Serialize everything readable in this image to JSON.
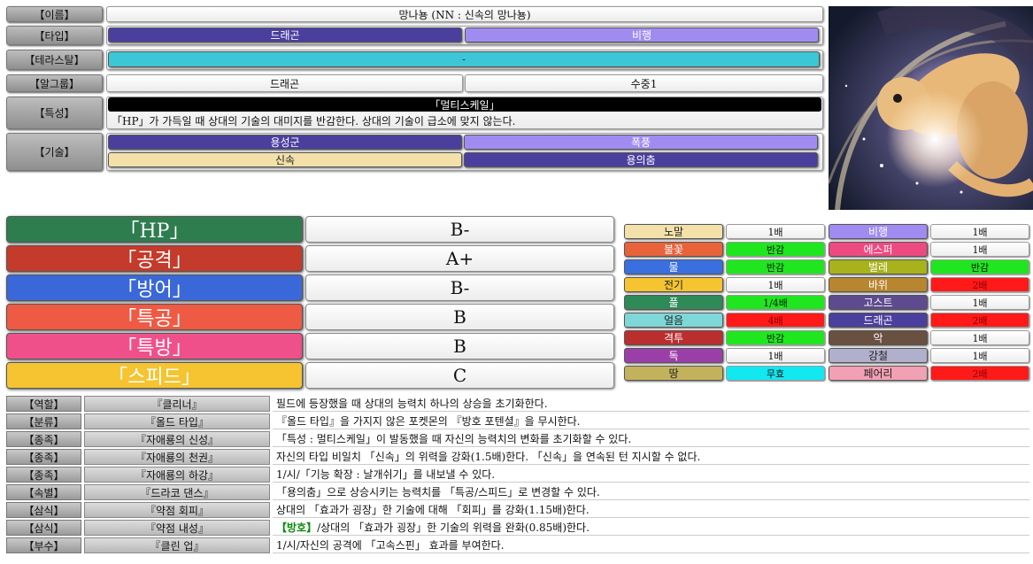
{
  "info": {
    "name_label": "【이름】",
    "name_value": "망나뇽 (NN : 신속의 망나뇽)",
    "type_label": "【타입】",
    "types": [
      {
        "name": "드래곤",
        "color": "#4b3f9e"
      },
      {
        "name": "비행",
        "color": "#a08cf0"
      }
    ],
    "tera_label": "【테라스탈】",
    "tera_value": "-",
    "tera_color": "#3cc6d6",
    "egg_label": "【알그룹】",
    "egg_groups": [
      "드래곤",
      "수중1"
    ],
    "ability_label": "【특성】",
    "ability_name": "「멀티스케일」",
    "ability_desc": "「HP」가 가득일 때 상대의 기술의 대미지를 반감한다. 상대의 기술이 급소에 맞지 않는다.",
    "moves_label": "【기술】",
    "moves": [
      {
        "name": "용성군",
        "color": "#4b3f9e"
      },
      {
        "name": "폭풍",
        "color": "#a08cf0"
      },
      {
        "name": "신속",
        "color": "#f3e1a9"
      },
      {
        "name": "용의춤",
        "color": "#4b3f9e"
      }
    ]
  },
  "artwork": {
    "name": "dragonite-artwork"
  },
  "stats": [
    {
      "label": "「HP」",
      "grade": "B-",
      "color": "#2e7d4f"
    },
    {
      "label": "「공격」",
      "grade": "A+",
      "color": "#c43a2b"
    },
    {
      "label": "「방어」",
      "grade": "B-",
      "color": "#3b68d8"
    },
    {
      "label": "「특공」",
      "grade": "B",
      "color": "#ee5a43"
    },
    {
      "label": "「특방」",
      "grade": "B",
      "color": "#f0508a"
    },
    {
      "label": "「스피드」",
      "grade": "C",
      "color": "#f5c430"
    }
  ],
  "effectiveness": [
    {
      "type": "노말",
      "type_color": "#f3e1a9",
      "type_text": "#222",
      "mult": "1배",
      "mult_color": ""
    },
    {
      "type": "비행",
      "type_color": "#a08cf0",
      "type_text": "#fff",
      "mult": "1배",
      "mult_color": ""
    },
    {
      "type": "불꽃",
      "type_color": "#e8623a",
      "type_text": "#fff",
      "mult": "반감",
      "mult_color": "#1fe61f"
    },
    {
      "type": "에스퍼",
      "type_color": "#ee4a82",
      "type_text": "#fff",
      "mult": "1배",
      "mult_color": ""
    },
    {
      "type": "물",
      "type_color": "#3a6fe0",
      "type_text": "#fff",
      "mult": "반감",
      "mult_color": "#1fe61f"
    },
    {
      "type": "벌레",
      "type_color": "#a8b21c",
      "type_text": "#fff",
      "mult": "반감",
      "mult_color": "#1fe61f"
    },
    {
      "type": "전기",
      "type_color": "#f5c430",
      "type_text": "#222",
      "mult": "1배",
      "mult_color": ""
    },
    {
      "type": "바위",
      "type_color": "#b8862e",
      "type_text": "#fff",
      "mult": "2배",
      "mult_color": "#ff1a1a"
    },
    {
      "type": "풀",
      "type_color": "#2e8b57",
      "type_text": "#fff",
      "mult": "1/4배",
      "mult_color": "#1fe61f"
    },
    {
      "type": "고스트",
      "type_color": "#5e4b8f",
      "type_text": "#fff",
      "mult": "1배",
      "mult_color": ""
    },
    {
      "type": "얼음",
      "type_color": "#7ed8d8",
      "type_text": "#222",
      "mult": "4배",
      "mult_color": "#ff1a1a"
    },
    {
      "type": "드래곤",
      "type_color": "#4b3f9e",
      "type_text": "#fff",
      "mult": "2배",
      "mult_color": "#ff1a1a"
    },
    {
      "type": "격투",
      "type_color": "#bb2e2e",
      "type_text": "#fff",
      "mult": "반감",
      "mult_color": "#1fe61f"
    },
    {
      "type": "악",
      "type_color": "#6a5040",
      "type_text": "#fff",
      "mult": "1배",
      "mult_color": ""
    },
    {
      "type": "독",
      "type_color": "#9b3fa8",
      "type_text": "#fff",
      "mult": "1배",
      "mult_color": ""
    },
    {
      "type": "강철",
      "type_color": "#b0b0cc",
      "type_text": "#222",
      "mult": "1배",
      "mult_color": ""
    },
    {
      "type": "땅",
      "type_color": "#c3b25c",
      "type_text": "#222",
      "mult": "무효",
      "mult_color": "#12e8f0"
    },
    {
      "type": "페어리",
      "type_color": "#f2a0b4",
      "type_text": "#222",
      "mult": "2배",
      "mult_color": "#ff1a1a"
    }
  ],
  "abilities": [
    {
      "category": "【역할】",
      "name": "『클리너』",
      "desc_pre": "필드에 등장했을 때 상대의 능력치 하나의 상승을 초기화한다.",
      "desc_hl": "",
      "desc_post": ""
    },
    {
      "category": "【분류】",
      "name": "『올드 타입』",
      "desc_pre": "『올드 타입』을 가지지 않은 포켓몬의 『방호 포텐셜』을 무시한다.",
      "desc_hl": "",
      "desc_post": ""
    },
    {
      "category": "【종족】",
      "name": "『자애룡의 신성』",
      "desc_pre": "「특성 : 멀티스케일」이 발동했을 때 자신의 능력치의 변화를 초기화할 수 있다.",
      "desc_hl": "",
      "desc_post": ""
    },
    {
      "category": "【종족】",
      "name": "『자애룡의 천권』",
      "desc_pre": "자신의 타입 비일치 「신속」의 위력을 강화(1.5배)한다. 「신속」을 연속된 턴 지시할 수 없다.",
      "desc_hl": "",
      "desc_post": ""
    },
    {
      "category": "【종족】",
      "name": "『자애룡의 하강』",
      "desc_pre": "1/시/「기능 확장 : 날개쉬기」를 내보낼 수 있다.",
      "desc_hl": "",
      "desc_post": ""
    },
    {
      "category": "【속별】",
      "name": "『드라코 댄스』",
      "desc_pre": "「용의춤」으로 상승시키는 능력치를 「특공/스피드」로 변경할 수 있다.",
      "desc_hl": "",
      "desc_post": ""
    },
    {
      "category": "【삼식】",
      "name": "『약점 회피』",
      "desc_pre": "상대의 「효과가 굉장」한 기술에 대해 「회피」를 강화(1.15배)한다.",
      "desc_hl": "",
      "desc_post": ""
    },
    {
      "category": "【삼식】",
      "name": "『약점 내성』",
      "desc_pre": "",
      "desc_hl": "【방호】",
      "desc_post": "/상대의 「효과가 굉장」한 기술의 위력을 완화(0.85배)한다."
    },
    {
      "category": "【부수】",
      "name": "『클린 업』",
      "desc_pre": "1/시/자신의 공격에 「고속스핀」 효과를 부여한다.",
      "desc_hl": "",
      "desc_post": ""
    }
  ]
}
